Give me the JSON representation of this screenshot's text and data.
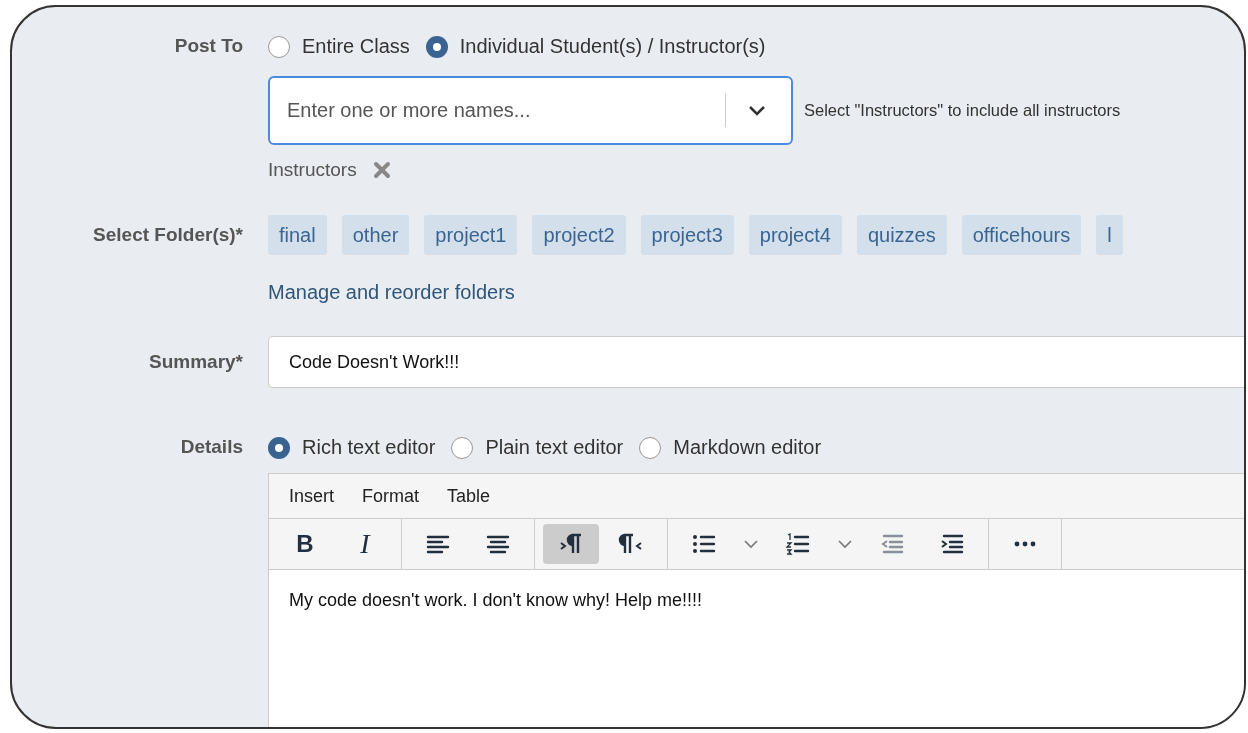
{
  "post_to": {
    "label": "Post To",
    "options": [
      {
        "label": "Entire Class",
        "selected": false
      },
      {
        "label": "Individual Student(s) / Instructor(s)",
        "selected": true
      }
    ],
    "recipients": {
      "placeholder": "Enter one or more names...",
      "hint": "Select \"Instructors\" to include all instructors"
    },
    "chosen": [
      {
        "label": "Instructors"
      }
    ]
  },
  "folders": {
    "label": "Select Folder(s)*",
    "items": [
      {
        "label": "final"
      },
      {
        "label": "other"
      },
      {
        "label": "project1"
      },
      {
        "label": "project2"
      },
      {
        "label": "project3"
      },
      {
        "label": "project4"
      },
      {
        "label": "quizzes"
      },
      {
        "label": "officehours"
      },
      {
        "label": "l"
      }
    ],
    "manage_link": "Manage and reorder folders"
  },
  "summary": {
    "label": "Summary*",
    "value": "Code Doesn't Work!!!"
  },
  "details": {
    "label": "Details",
    "editors": [
      {
        "label": "Rich text editor",
        "selected": true
      },
      {
        "label": "Plain text editor",
        "selected": false
      },
      {
        "label": "Markdown editor",
        "selected": false
      }
    ],
    "menu": [
      "Insert",
      "Format",
      "Table"
    ],
    "toolbar": [
      [
        {
          "kind": "bold",
          "text": "B",
          "selected": false,
          "disabled": false
        },
        {
          "kind": "italic",
          "text": "I",
          "selected": false,
          "disabled": false
        }
      ],
      [
        {
          "kind": "align-left",
          "selected": false,
          "disabled": false
        },
        {
          "kind": "align-center",
          "selected": false,
          "disabled": false
        }
      ],
      [
        {
          "kind": "ltr",
          "selected": true,
          "disabled": false
        },
        {
          "kind": "rtl",
          "selected": false,
          "disabled": false
        }
      ],
      [
        {
          "kind": "bullets",
          "selected": false,
          "disabled": false
        },
        {
          "kind": "caret",
          "selected": false,
          "disabled": false
        },
        {
          "kind": "numbers",
          "selected": false,
          "disabled": false
        },
        {
          "kind": "caret",
          "selected": false,
          "disabled": false
        },
        {
          "kind": "outdent",
          "selected": false,
          "disabled": true
        },
        {
          "kind": "indent",
          "selected": false,
          "disabled": false
        }
      ],
      [
        {
          "kind": "more",
          "selected": false,
          "disabled": false
        }
      ]
    ],
    "body": "My code doesn't work. I don't know why! Help me!!!!"
  }
}
